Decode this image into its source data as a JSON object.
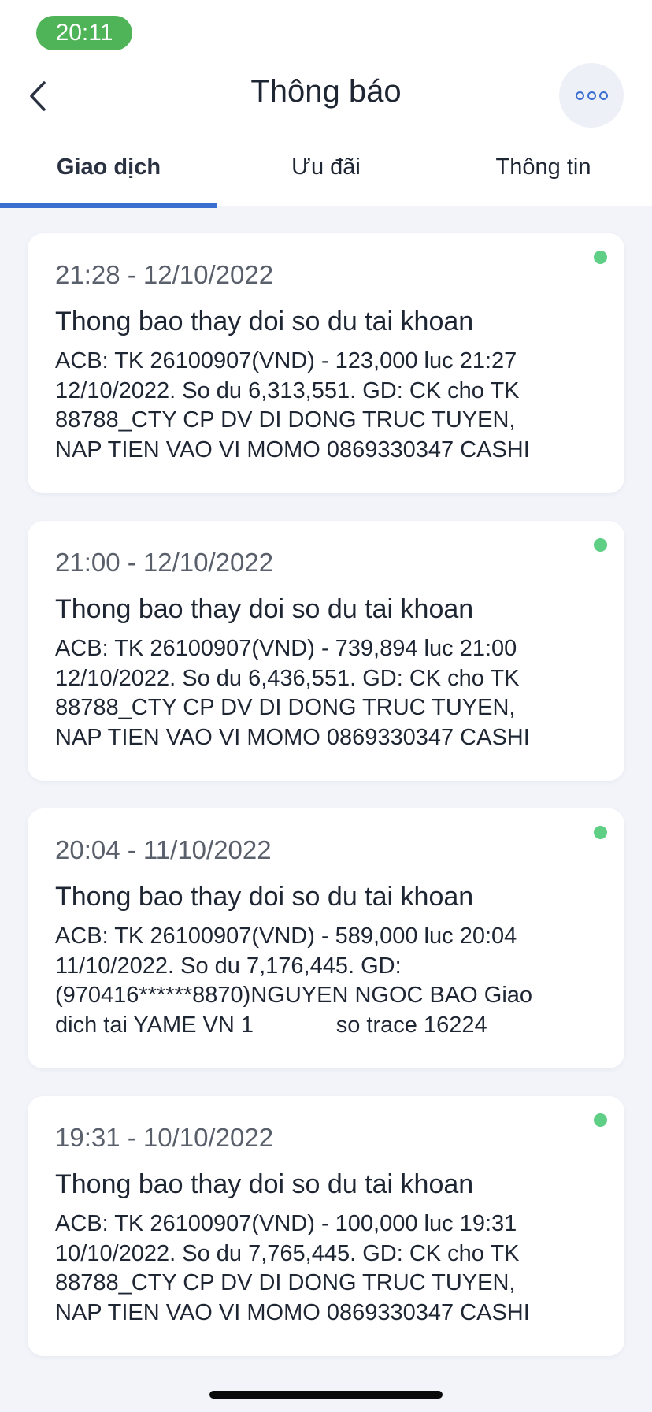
{
  "status_bar": {
    "time": "20:11"
  },
  "header": {
    "title": "Thông báo",
    "back_icon": "chevron-left-icon",
    "more_icon": "more-dots-icon"
  },
  "tabs": [
    {
      "label": "Giao dịch",
      "active": true
    },
    {
      "label": "Ưu đãi",
      "active": false
    },
    {
      "label": "Thông tin",
      "active": false
    }
  ],
  "colors": {
    "accent": "#3a6fd0",
    "status_pill": "#4fb457",
    "unread_dot": "#5fcf85"
  },
  "notifications": [
    {
      "time": "21:28 - 12/10/2022",
      "title": "Thong bao thay doi so du tai khoan",
      "body": "ACB: TK 26100907(VND) - 123,000 luc 21:27\n12/10/2022. So du 6,313,551. GD: CK cho TK\n88788_CTY CP DV DI DONG TRUC TUYEN,\nNAP TIEN VAO VI MOMO 0869330347 CASHI",
      "unread": true
    },
    {
      "time": "21:00 - 12/10/2022",
      "title": "Thong bao thay doi so du tai khoan",
      "body": "ACB: TK 26100907(VND) - 739,894 luc 21:00\n12/10/2022. So du 6,436,551. GD: CK cho TK\n88788_CTY CP DV DI DONG TRUC TUYEN,\nNAP TIEN VAO VI MOMO 0869330347 CASHI",
      "unread": true
    },
    {
      "time": "20:04 - 11/10/2022",
      "title": "Thong bao thay doi so du tai khoan",
      "body": "ACB: TK 26100907(VND) - 589,000 luc 20:04\n11/10/2022. So du 7,176,445. GD:\n(970416******8870)NGUYEN NGOC BAO Giao\ndich tai YAME VN 1             so trace 16224",
      "unread": true
    },
    {
      "time": "19:31 - 10/10/2022",
      "title": "Thong bao thay doi so du tai khoan",
      "body": "ACB: TK 26100907(VND) - 100,000 luc 19:31\n10/10/2022. So du 7,765,445. GD: CK cho TK\n88788_CTY CP DV DI DONG TRUC TUYEN,\nNAP TIEN VAO VI MOMO 0869330347 CASHI",
      "unread": true
    }
  ]
}
